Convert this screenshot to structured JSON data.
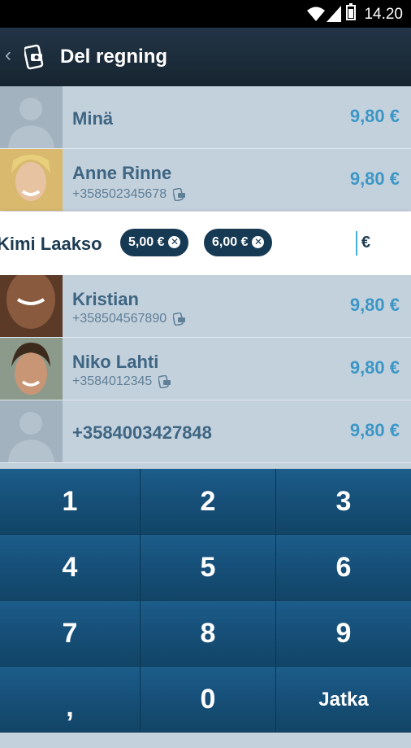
{
  "status_bar": {
    "time": "14.20"
  },
  "action_bar": {
    "title": "Del regning"
  },
  "contacts": [
    {
      "name": "Minä",
      "phone": "",
      "amount": "9,80 €",
      "avatar": "silhouette"
    },
    {
      "name": "Anne Rinne",
      "phone": "+358502345678",
      "amount": "9,80 €",
      "avatar": "photo"
    },
    {
      "name": "Kristian",
      "phone": "+358504567890",
      "amount": "9,80 €",
      "avatar": "photo"
    },
    {
      "name": "Niko Lahti",
      "phone": "+3584012345",
      "amount": "9,80 €",
      "avatar": "photo"
    },
    {
      "name": "+3584003427848",
      "phone": "",
      "amount": "9,80 €",
      "avatar": "silhouette"
    }
  ],
  "editing": {
    "name": "Kimi Laakso",
    "chips": [
      "5,00 €",
      "6,00 €"
    ],
    "currency": "€",
    "input_value": ""
  },
  "keypad": {
    "keys": [
      "1",
      "2",
      "3",
      "4",
      "5",
      "6",
      "7",
      "8",
      "9",
      ",",
      "0",
      "Jatka"
    ]
  }
}
